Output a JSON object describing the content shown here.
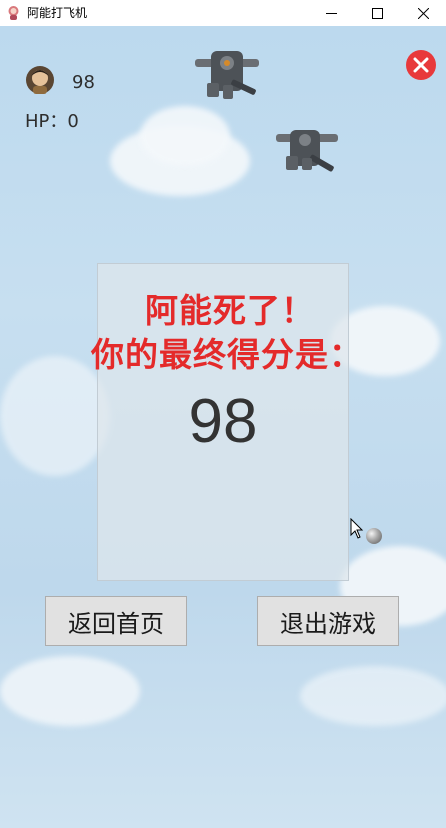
{
  "window": {
    "title": "阿能打飞机",
    "app_icon": "app-avatar-icon",
    "controls": [
      "minimize-icon",
      "maximize-icon",
      "close-icon"
    ]
  },
  "hud": {
    "score": "98",
    "hp_label": "HP：",
    "hp_value": "0",
    "avatar_icon": "player-avatar-icon",
    "close_icon": "close-game-icon",
    "close_color": "#e8393b"
  },
  "game_over": {
    "line1": "阿能死了！",
    "line2": "你的最终得分是：",
    "final_score": "98",
    "text_color": "#e42a2a"
  },
  "buttons": {
    "home": "返回首页",
    "exit": "退出游戏"
  },
  "sprites": [
    "enemy-plane-icon",
    "enemy-plane-icon",
    "bullet-icon",
    "cursor-icon"
  ]
}
